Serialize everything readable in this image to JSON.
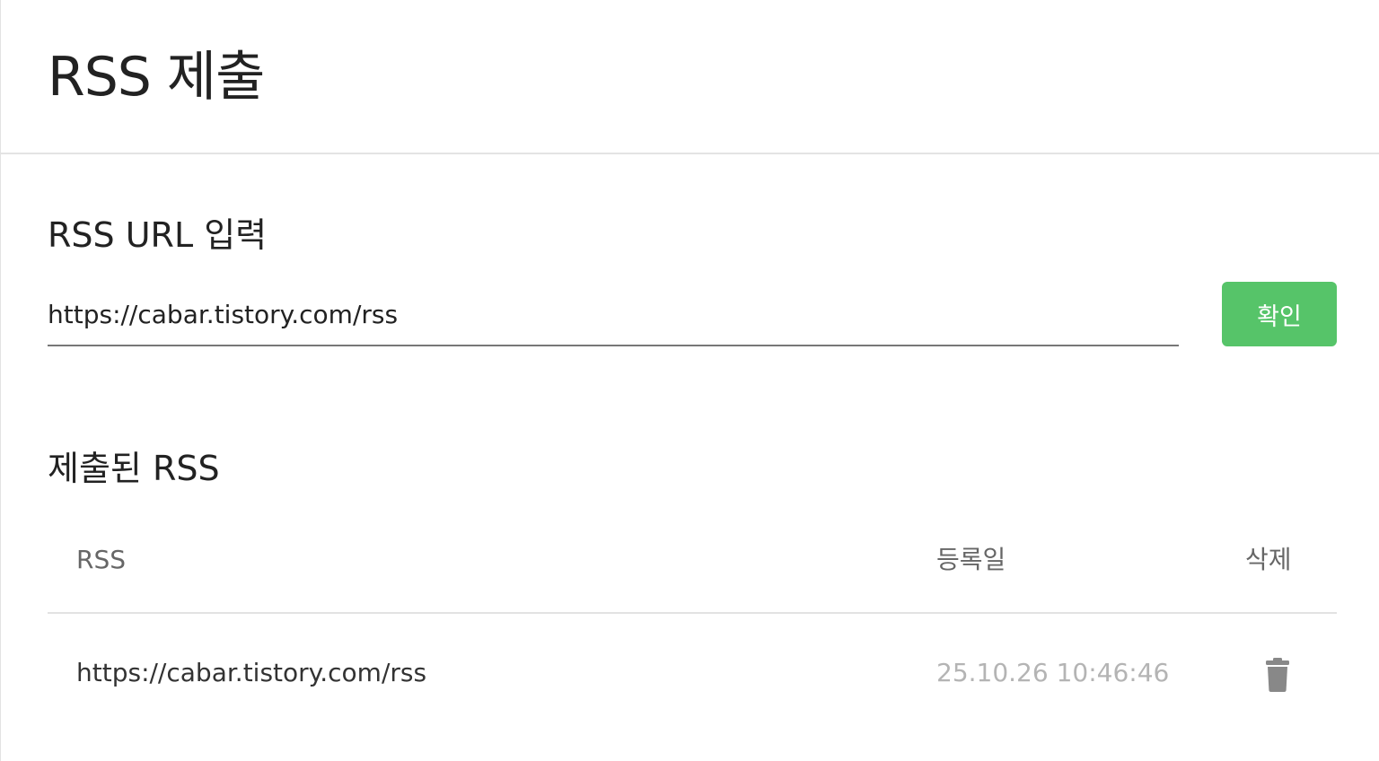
{
  "page": {
    "title": "RSS 제출"
  },
  "url_section": {
    "title": "RSS URL 입력",
    "input_value": "https://cabar.tistory.com/rss",
    "confirm_label": "확인"
  },
  "submitted_section": {
    "title": "제출된 RSS",
    "columns": [
      "RSS",
      "등록일",
      "삭제"
    ],
    "rows": [
      {
        "rss": "https://cabar.tistory.com/rss",
        "registered": "25.10.26 10:46:46",
        "delete_icon": "trash-icon"
      }
    ]
  },
  "colors": {
    "accent": "#56c469",
    "icon": "#888888",
    "muted_text": "#b4b4b4"
  }
}
